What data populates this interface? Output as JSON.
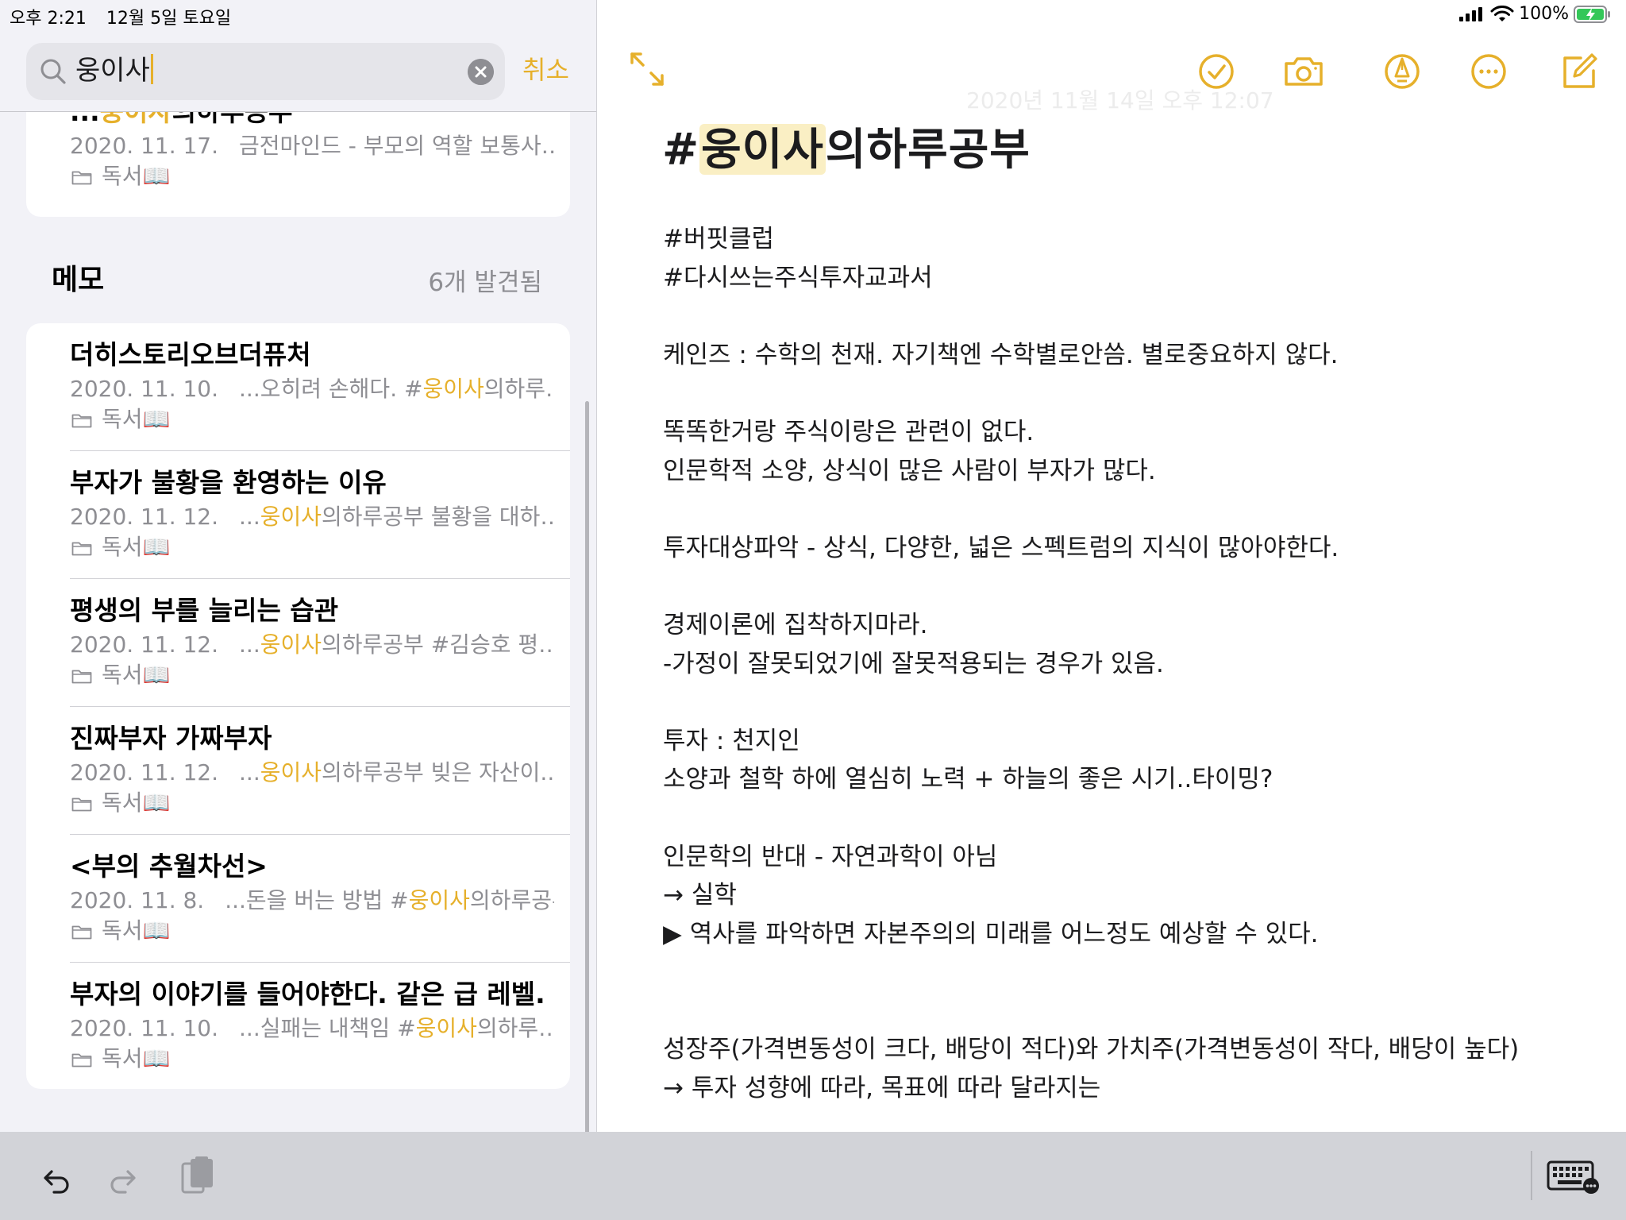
{
  "status_bar": {
    "time": "오후 2:21",
    "date": "12월 5일 토요일",
    "battery": "100%"
  },
  "search": {
    "query": "웅이사",
    "cancel_label": "취소"
  },
  "top_result": {
    "title_prefix": "...",
    "title_highlight": "웅이사",
    "title_suffix": "의하루공부",
    "date": "2020. 11. 17.",
    "snippet": "금전마인드 - 부모의 역할 보통사…",
    "folder": "독서📖"
  },
  "memo_section": {
    "header": "메모",
    "count": "6개 발견됨"
  },
  "notes": [
    {
      "title": "더히스토리오브더퓨처",
      "date": "2020. 11. 10.",
      "snippet_before": "...오히려 손해다. #",
      "snippet_highlight": "웅이사",
      "snippet_after": "의하루…",
      "folder": "독서📖"
    },
    {
      "title": "부자가 불황을 환영하는 이유",
      "date": "2020. 11. 12.",
      "snippet_before": "...",
      "snippet_highlight": "웅이사",
      "snippet_after": "의하루공부 불황을 대하…",
      "folder": "독서📖"
    },
    {
      "title": "평생의 부를 늘리는 습관",
      "date": "2020. 11. 12.",
      "snippet_before": "...",
      "snippet_highlight": "웅이사",
      "snippet_after": "의하루공부 #김승호 평…",
      "folder": "독서📖"
    },
    {
      "title": "진짜부자 가짜부자",
      "date": "2020. 11. 12.",
      "snippet_before": "...",
      "snippet_highlight": "웅이사",
      "snippet_after": "의하루공부 빚은 자산이...",
      "folder": "독서📖"
    },
    {
      "title": "<부의 추월차선>",
      "date": "2020. 11. 8.",
      "snippet_before": "...돈을 버는 방법 #",
      "snippet_highlight": "웅이사",
      "snippet_after": "의하루공부",
      "folder": "독서📖"
    },
    {
      "title": "부자의 이야기를 들어야한다. 같은 급 레벨...",
      "date": "2020. 11. 10.",
      "snippet_before": "...실패는 내책임 #",
      "snippet_highlight": "웅이사",
      "snippet_after": "의하루…",
      "folder": "독서📖"
    }
  ],
  "note": {
    "faded_date": "2020년 11월 14일 오후 12:07",
    "title_prefix": "#",
    "title_highlight": "웅이사",
    "title_suffix": "의하루공부",
    "body_lines": [
      "#버핏클럽",
      "#다시쓰는주식투자교과서",
      "",
      "케인즈 : 수학의 천재. 자기책엔 수학별로안씀. 별로중요하지 않다.",
      "",
      "똑똑한거랑 주식이랑은 관련이 없다.",
      "인문학적 소양, 상식이 많은 사람이 부자가 많다.",
      "",
      "투자대상파악 - 상식, 다양한, 넓은 스펙트럼의 지식이 많아야한다.",
      "",
      "경제이론에 집착하지마라.",
      "-가정이 잘못되었기에 잘못적용되는 경우가 있음.",
      "",
      "투자 : 천지인",
      "소양과 철학 하에 열심히 노력 + 하늘의 좋은 시기..타이밍?",
      "",
      "인문학의 반대 - 자연과학이 아님",
      "→ 실학",
      "▶ 역사를 파악하면 자본주의의 미래를 어느정도 예상할 수 있다.",
      "",
      "",
      "성장주(가격변동성이 크다, 배당이 적다)와 가치주(가격변동성이 작다, 배당이 높다)",
      "→ 투자 성향에 따라, 목표에 따라 달라지는"
    ]
  },
  "colors": {
    "accent": "#e6b02b",
    "highlight_bg": "#faefc4",
    "secondary_text": "#8e8e93",
    "sidebar_bg": "#f2f2f7",
    "toolbar_bg": "#d2d3d8"
  },
  "icons": {
    "search": "search-icon",
    "clear": "clear-icon",
    "folder": "folder-icon",
    "expand": "expand-icon",
    "checklist": "checklist-icon",
    "camera": "camera-icon",
    "markup": "markup-pen-icon",
    "more": "more-ellipsis-icon",
    "compose": "compose-icon",
    "undo": "undo-icon",
    "redo": "redo-icon",
    "paste": "clipboard-icon",
    "keyboard": "keyboard-icon"
  }
}
